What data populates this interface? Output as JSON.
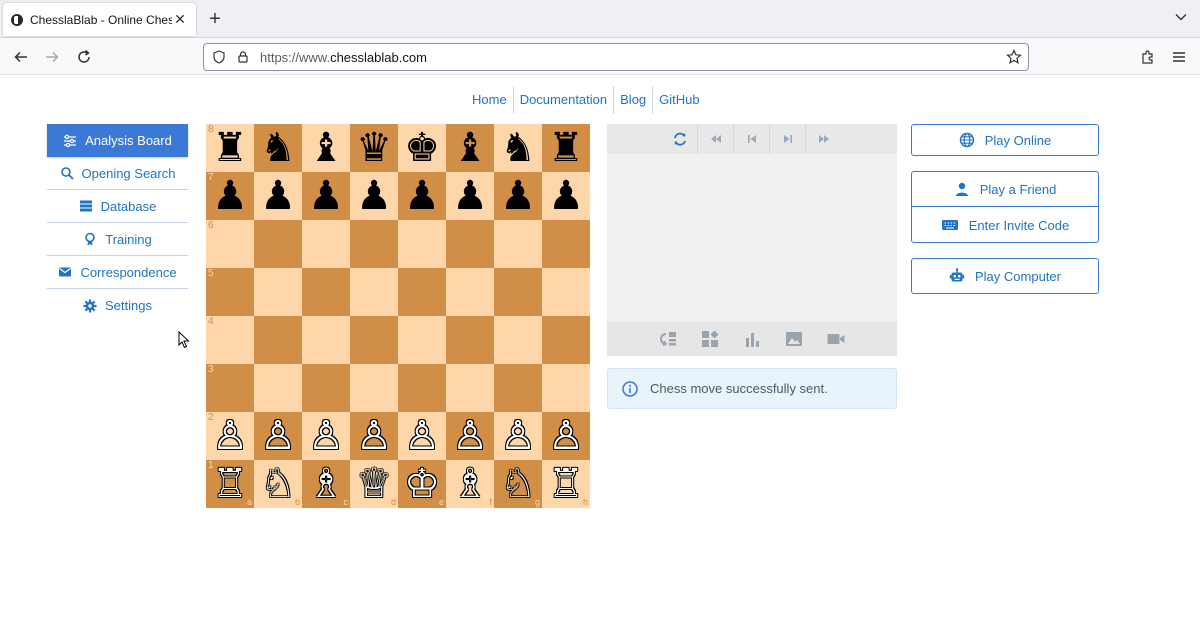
{
  "browser": {
    "tab_title": "ChesslaBlab - Online Chess",
    "url_prefix": "https://www.",
    "url_domain": "chesslablab.com"
  },
  "site_nav": [
    "Home",
    "Documentation",
    "Blog",
    "GitHub"
  ],
  "sidebar": {
    "items": [
      {
        "label": "Analysis Board",
        "icon": "sliders-icon",
        "active": true
      },
      {
        "label": "Opening Search",
        "icon": "search-icon"
      },
      {
        "label": "Database",
        "icon": "database-icon"
      },
      {
        "label": "Training",
        "icon": "award-icon"
      },
      {
        "label": "Correspondence",
        "icon": "envelope-icon"
      },
      {
        "label": "Settings",
        "icon": "gear-icon"
      }
    ]
  },
  "board": {
    "ranks": [
      "8",
      "7",
      "6",
      "5",
      "4",
      "3",
      "2",
      "1"
    ],
    "files": [
      "a",
      "b",
      "c",
      "d",
      "e",
      "f",
      "g",
      "h"
    ],
    "position": [
      [
        "♜",
        "♞",
        "♝",
        "♛",
        "♚",
        "♝",
        "♞",
        "♜"
      ],
      [
        "♟",
        "♟",
        "♟",
        "♟",
        "♟",
        "♟",
        "♟",
        "♟"
      ],
      [
        "",
        "",
        "",
        "",
        "",
        "",
        "",
        ""
      ],
      [
        "",
        "",
        "",
        "",
        "",
        "",
        "",
        ""
      ],
      [
        "",
        "",
        "",
        "",
        "",
        "",
        "",
        ""
      ],
      [
        "",
        "",
        "",
        "",
        "",
        "",
        "",
        ""
      ],
      [
        "♙",
        "♙",
        "♙",
        "♙",
        "♙",
        "♙",
        "♙",
        "♙"
      ],
      [
        "♖",
        "♘",
        "♗",
        "♕",
        "♔",
        "♗",
        "♘",
        "♖"
      ]
    ],
    "colors": {
      "light": "#fdd7a9",
      "dark": "#d18e46"
    }
  },
  "alert": {
    "message": "Chess move successfully sent."
  },
  "actions": {
    "play_online": "Play Online",
    "play_friend": "Play a Friend",
    "invite_code": "Enter Invite Code",
    "play_computer": "Play Computer"
  },
  "colors": {
    "accent": "#3a79d6",
    "link": "#1f74c4"
  }
}
